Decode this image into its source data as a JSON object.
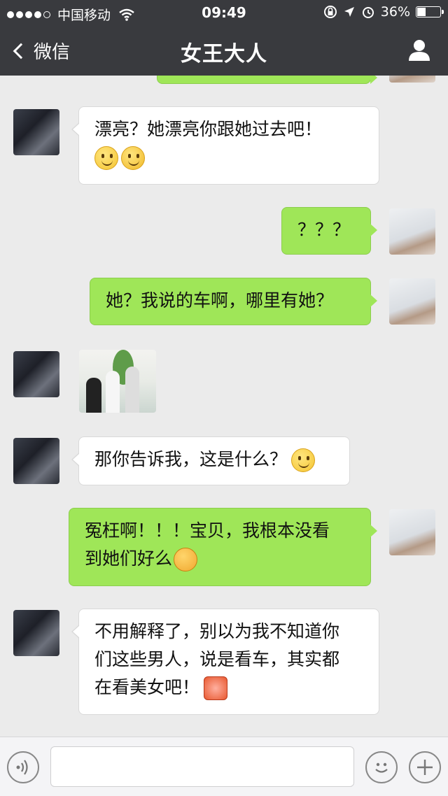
{
  "status_bar": {
    "carrier": "中国移动",
    "time": "09:49",
    "battery_percent": "36%",
    "battery_level": 0.36
  },
  "nav": {
    "back_label": "微信",
    "title": "女王大人"
  },
  "messages": [
    {
      "sender": "her",
      "type": "text",
      "text": "漂亮？她漂亮你跟她过去吧！",
      "emojis": [
        "smile-emoji",
        "thinking-emoji"
      ]
    },
    {
      "sender": "me",
      "type": "text",
      "text": "？？？"
    },
    {
      "sender": "me",
      "type": "text",
      "text": "她？我说的车啊，哪里有她？"
    },
    {
      "sender": "her",
      "type": "image"
    },
    {
      "sender": "her",
      "type": "text",
      "text": "那你告诉我，这是什么？",
      "emojis": [
        "smile-emoji"
      ]
    },
    {
      "sender": "me",
      "type": "text",
      "text_lines": [
        "冤枉啊！！！宝贝，我根本没看",
        "到她们好么"
      ],
      "emojis": [
        "crying-emoji"
      ]
    },
    {
      "sender": "her",
      "type": "text",
      "text_lines": [
        "不用解释了，别以为我不知道你",
        "们这些男人，说是看车，其实都",
        "在看美女吧！"
      ],
      "emojis": [
        "angry-emoji"
      ]
    }
  ]
}
